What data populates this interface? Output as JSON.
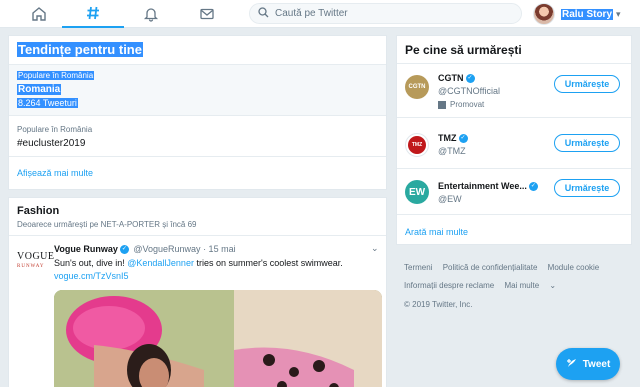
{
  "nav": {
    "items": [
      {
        "name": "home",
        "icon": "home-icon",
        "active": false
      },
      {
        "name": "explore",
        "icon": "hashtag-icon",
        "active": true
      },
      {
        "name": "notifications",
        "icon": "bell-icon",
        "active": false
      },
      {
        "name": "messages",
        "icon": "mail-icon",
        "active": false
      }
    ],
    "search_placeholder": "Caută pe Twitter",
    "profile_name": "Ralu Story"
  },
  "trends": {
    "title": "Tendințe pentru tine",
    "items": [
      {
        "context": "Populare în România",
        "name": "Romania",
        "count": "8.264 Tweeturi"
      },
      {
        "context": "Populare în România",
        "name": "#eucluster2019",
        "count": ""
      }
    ],
    "show_more": "Afișează mai multe"
  },
  "fashion": {
    "title": "Fashion",
    "subtitle": "Deoarece urmărești pe NET-A-PORTER și încă 69",
    "tweet": {
      "logo_line1": "VOGUE",
      "logo_line2": "RUNWAY",
      "author": "Vogue Runway",
      "handle": "@VogueRunway",
      "date": "· 15 mai",
      "text_before": "Sun's out, dive in! ",
      "mention": "@KendallJenner",
      "text_after": " tries on summer's coolest swimwear.",
      "link": "vogue.cm/TzVsnI5"
    }
  },
  "who_to_follow": {
    "title": "Pe cine să urmărești",
    "accounts": [
      {
        "name": "CGTN",
        "handle": "@CGTNOfficial",
        "promoted": "Promovat",
        "avatar_text": "CGTN",
        "avatar_bg": "#b79a5a",
        "button": "Urmărește"
      },
      {
        "name": "TMZ",
        "handle": "@TMZ",
        "promoted": "",
        "avatar_text": "TMZ",
        "avatar_bg": "#c0181b",
        "button": "Urmărește"
      },
      {
        "name": "Entertainment Wee...",
        "handle": "@EW",
        "promoted": "",
        "avatar_text": "EW",
        "avatar_bg": "#2aa9a0",
        "button": "Urmărește"
      }
    ],
    "show_more": "Arată mai multe"
  },
  "footer": {
    "links_row1": [
      "Termeni",
      "Politică de confidențialitate",
      "Module cookie"
    ],
    "links_row2": [
      "Informații despre reclame",
      "Mai multe"
    ],
    "copyright": "© 2019 Twitter, Inc."
  },
  "tweet_button": "Tweet",
  "colors": {
    "accent": "#1da1f2",
    "background": "#e6ecf0",
    "selection": "#3390ff"
  }
}
